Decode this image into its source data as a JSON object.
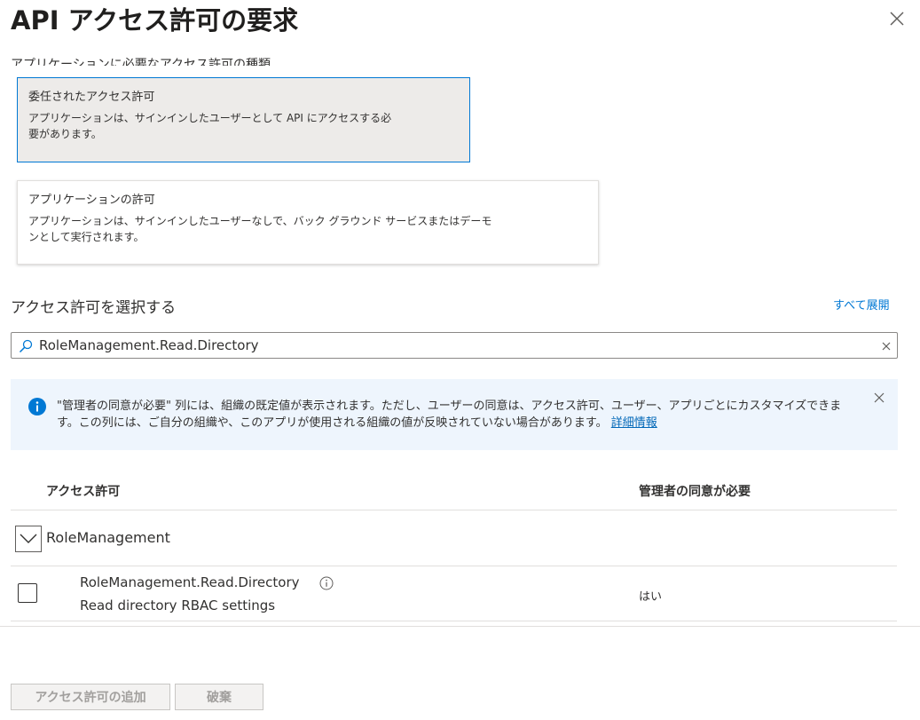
{
  "header": {
    "title": "API アクセス許可の要求"
  },
  "partial_heading": "アプリケーションに必要なアクセス許可の種類",
  "permission_types": [
    {
      "title": "委任されたアクセス許可",
      "description": "アプリケーションは、サインインしたユーザーとして API にアクセスする必要があります。",
      "selected": true
    },
    {
      "title": "アプリケーションの許可",
      "description": "アプリケーションは、サインインしたユーザーなしで、バック グラウンド サービスまたはデーモンとして実行されます。",
      "selected": false
    }
  ],
  "select_section": {
    "title": "アクセス許可を選択する",
    "expand_all": "すべて展開"
  },
  "search": {
    "value": "RoleManagement.Read.Directory",
    "placeholder": ""
  },
  "info_bar": {
    "text": "\"管理者の同意が必要\" 列には、組織の既定値が表示されます。ただし、ユーザーの同意は、アクセス許可、ユーザー、アプリごとにカスタマイズできます。この列には、ご自分の組織や、このアプリが使用される組織の値が反映されていない場合があります。",
    "link": "詳細情報"
  },
  "table": {
    "columns": [
      "アクセス許可",
      "管理者の同意が必要"
    ],
    "groups": [
      {
        "name": "RoleManagement",
        "expanded": true,
        "permissions": [
          {
            "name": "RoleManagement.Read.Directory",
            "description": "Read directory RBAC settings",
            "admin_consent": "はい",
            "checked": false
          }
        ]
      }
    ]
  },
  "footer": {
    "add_label": "アクセス許可の追加",
    "discard_label": "破棄"
  },
  "colors": {
    "accent": "#0078d4",
    "link": "#0067b8",
    "info_bg": "#eef5fd",
    "selected_bg": "#edebe9"
  }
}
